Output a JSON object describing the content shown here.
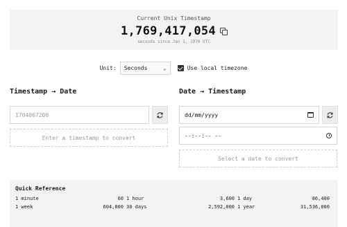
{
  "banner": {
    "label": "Current Unix Timestamp",
    "value": "1,769,417,054",
    "subtitle": "seconds since Jan 1, 1970 UTC"
  },
  "options": {
    "unit_label": "Unit:",
    "unit_value": "Seconds",
    "timezone_label": "Use local timezone",
    "timezone_checked": true
  },
  "left": {
    "title": "Timestamp → Date",
    "input_placeholder": "1704067200",
    "result_placeholder": "Enter a timestamp to convert"
  },
  "right": {
    "title": "Date → Timestamp",
    "date_value": "dd/mm/yyyy",
    "time_value": "--:--:-- --",
    "result_placeholder": "Select a date to convert"
  },
  "quick_reference": {
    "title": "Quick Reference",
    "rows": [
      [
        {
          "label": "1 minute",
          "value": "60"
        },
        {
          "label": "1 hour",
          "value": "3,600"
        },
        {
          "label": "1 day",
          "value": "86,400"
        }
      ],
      [
        {
          "label": "1 week",
          "value": "604,800"
        },
        {
          "label": "30 days",
          "value": "2,592,000"
        },
        {
          "label": "1 year",
          "value": "31,536,000"
        }
      ]
    ]
  }
}
